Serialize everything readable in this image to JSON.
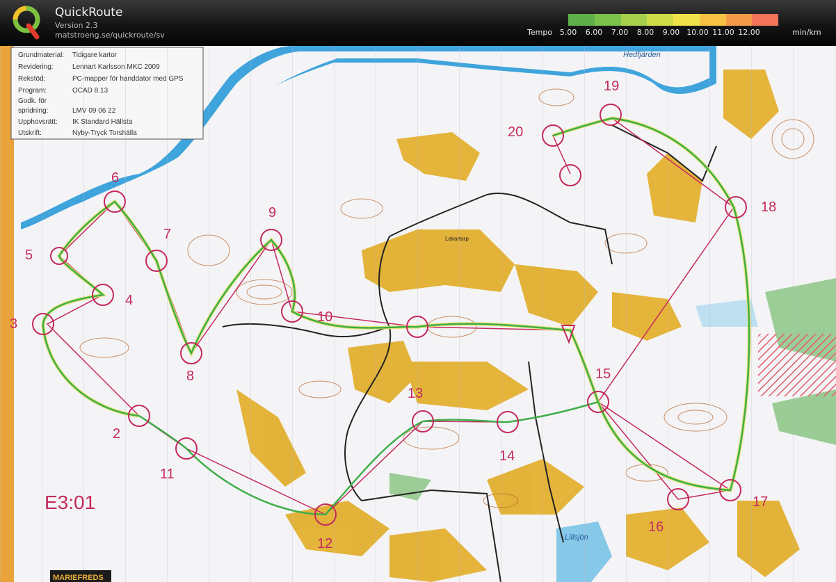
{
  "app": {
    "title": "QuickRoute",
    "version": "Version 2.3",
    "url": "matstroeng.se/quickroute/sv"
  },
  "legend": {
    "label": "Tempo",
    "unit": "min/km",
    "ticks": [
      "5.00",
      "6.00",
      "7.00",
      "8.00",
      "9.00",
      "10.00",
      "11.00",
      "12.00"
    ],
    "colors": [
      "#5fb04a",
      "#7cc14b",
      "#a6d04c",
      "#cfdc4a",
      "#f0e24a",
      "#f7c244",
      "#f59a48",
      "#f0735a"
    ]
  },
  "map": {
    "info_rows": [
      {
        "label": "Grundmaterial:",
        "value": "Tidigare kartor"
      },
      {
        "label": "Revidering:",
        "value": "Lennart Karlsson MKC 2009"
      },
      {
        "label": "Rekstöd:",
        "value": "PC-mapper för handdator med GPS"
      },
      {
        "label": "Program:",
        "value": "OCAD 8.13"
      },
      {
        "label": "Godk. för",
        "value": ""
      },
      {
        "label": "spridning:",
        "value": "LMV 09 06 22"
      },
      {
        "label": "Upphovsrätt:",
        "value": "IK Standard Hällsta"
      },
      {
        "label": "Utskrift:",
        "value": "Nyby-Tryck Torshälla"
      }
    ],
    "controls": [
      "2",
      "3",
      "4",
      "5",
      "6",
      "7",
      "8",
      "9",
      "10",
      "11",
      "12",
      "13",
      "14",
      "15",
      "16",
      "17",
      "18",
      "19",
      "20"
    ],
    "course_code": "E3:01",
    "place_names": {
      "hedfjarden": "Hedfjärden",
      "lekartorp": "Lekartorp",
      "lillsjon": "Lillsjön"
    },
    "bottom_logo": "MARIEFREDS"
  }
}
